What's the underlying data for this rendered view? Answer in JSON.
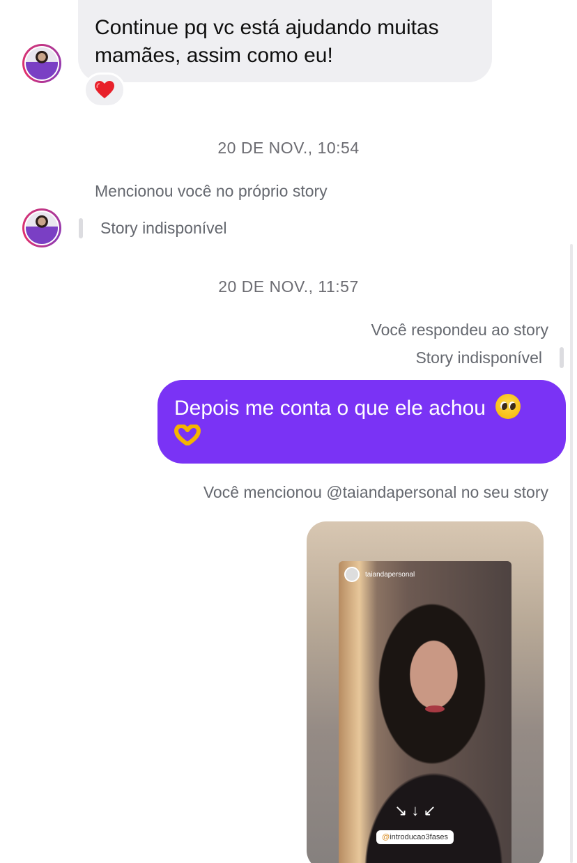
{
  "messages": {
    "received_text": "Continue pq vc está ajudando muitas mamães, assim como eu!",
    "reaction_icon": "heart-icon",
    "timestamp_1": "20 DE NOV., 10:54",
    "mentioned_story": "Mencionou você no próprio story",
    "story_unavailable_left": "Story indisponível",
    "timestamp_2": "20 DE NOV., 11:57",
    "you_replied_story": "Você respondeu ao story",
    "story_unavailable_right": "Story indisponível",
    "sent_text": "Depois me conta o que ele achou",
    "you_mentioned": "Você mencionou @taiandapersonal no seu story"
  },
  "story_card": {
    "username": "taiandapersonal",
    "arrows": "↘↓↙",
    "mention_at": "@",
    "mention": "introducao3fases"
  },
  "colors": {
    "sent_bubble": "#7a33f5",
    "received_bubble": "#efeff2",
    "avatar_ring": "#c13584"
  }
}
